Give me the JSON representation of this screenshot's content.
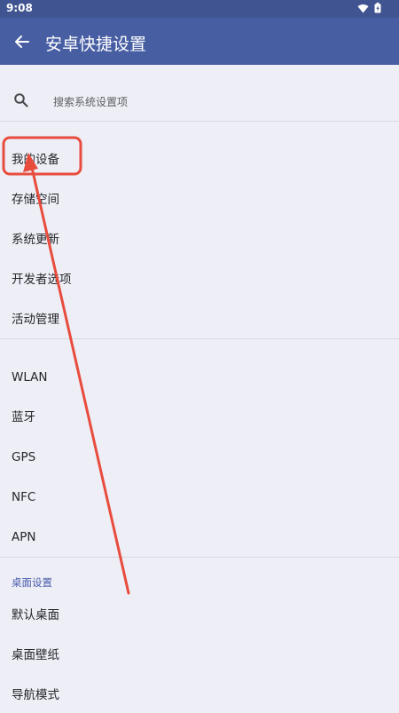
{
  "status_bar": {
    "time": "9:08",
    "wifi_icon": "wifi-icon",
    "battery_icon": "battery-icon"
  },
  "app_bar": {
    "title": "安卓快捷设置",
    "back_icon": "arrow-left-icon"
  },
  "search": {
    "placeholder": "搜索系统设置项",
    "icon": "search-icon"
  },
  "groups": {
    "device": [
      "我的设备",
      "存储空间",
      "系统更新",
      "开发者选项",
      "活动管理"
    ],
    "network": [
      "WLAN",
      "蓝牙",
      "GPS",
      "NFC",
      "APN"
    ],
    "desktop": {
      "header": "桌面设置",
      "items": [
        "默认桌面",
        "桌面壁纸",
        "导航模式"
      ]
    }
  },
  "colors": {
    "status_bar": "#3f5491",
    "app_bar": "#475ea3",
    "background": "#eeeef7",
    "section_header": "#4b5eac",
    "annotation": "#e84c3d"
  }
}
